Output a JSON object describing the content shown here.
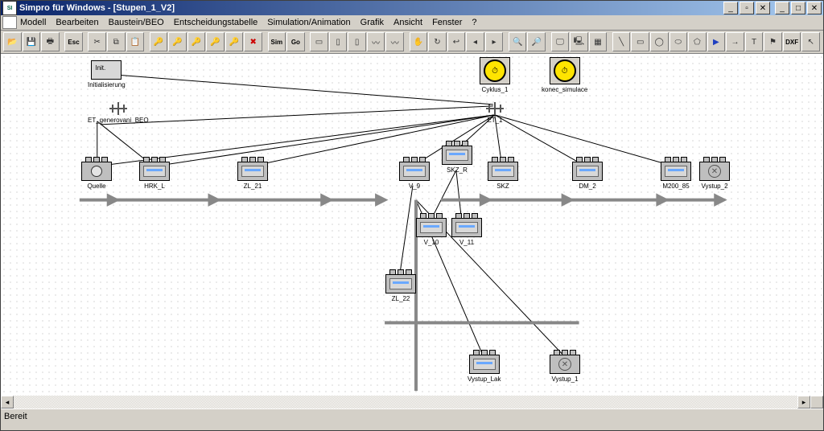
{
  "window_title": "Simpro für Windows - [Stupen_1_V2]",
  "menu": [
    "Modell",
    "Bearbeiten",
    "Baustein/BEO",
    "Entscheidungstabelle",
    "Simulation/Animation",
    "Grafik",
    "Ansicht",
    "Fenster",
    "?"
  ],
  "status": "Bereit",
  "winbtns": {
    "min": "_",
    "doc_min": "_",
    "doc_max": "▫",
    "max": "□",
    "close": "✕"
  },
  "toolbar_icons": [
    "open",
    "save",
    "print",
    "esc",
    "cut",
    "copy",
    "paste",
    "key1",
    "key2",
    "key3",
    "key4",
    "key5",
    "del",
    "sim",
    "go",
    "step1",
    "step2",
    "step3",
    "step4",
    "step5",
    "hand",
    "rot",
    "rev",
    "back",
    "fwd",
    "find",
    "find-next",
    "monitor",
    "pc",
    "chip",
    "line",
    "rect",
    "circ",
    "rrect",
    "poly",
    "tri-fill",
    "arrow",
    "text",
    "flag",
    "dxf",
    "cursor"
  ],
  "icon_glyph": {
    "open": "📂",
    "save": "💾",
    "print": "🖶",
    "esc": "Esc",
    "cut": "✂",
    "copy": "⧉",
    "paste": "📋",
    "key1": "🔑",
    "key2": "🔑",
    "key3": "🔑",
    "key4": "🔑",
    "key5": "🔑",
    "del": "✖",
    "sim": "Sim",
    "go": "Go",
    "step1": "▭",
    "step2": "▯",
    "step3": "▯",
    "step4": "〰",
    "step5": "〰",
    "hand": "✋",
    "rot": "↻",
    "rev": "↩",
    "back": "◂",
    "fwd": "▸",
    "find": "🔍",
    "find-next": "🔎",
    "monitor": "🖵",
    "pc": "🖳",
    "chip": "▦",
    "line": "╲",
    "rect": "▭",
    "circ": "◯",
    "rrect": "⬭",
    "poly": "⬠",
    "tri-fill": "▶",
    "arrow": "→",
    "text": "T",
    "flag": "⚑",
    "dxf": "DXF",
    "cursor": "↖"
  },
  "icon_color": {
    "del": "#c00",
    "tri-fill": "#2040c0",
    "sim": "#000",
    "go": "#000",
    "dxf": "#000",
    "esc": "#000"
  },
  "nodes": {
    "init": {
      "label": "Initialisierung"
    },
    "etgen": {
      "label": "ET_generovani_BEO"
    },
    "cyklus": {
      "label": "Cyklus_1"
    },
    "konec": {
      "label": "konec_simulace"
    },
    "et1": {
      "label": "ET_1"
    },
    "quelle": {
      "label": "Quelle"
    },
    "hrk": {
      "label": "HRK_L"
    },
    "zl21": {
      "label": "ZL_21"
    },
    "v9": {
      "label": "V_9"
    },
    "skzr": {
      "label": "SKZ_R"
    },
    "skz": {
      "label": "SKZ"
    },
    "dm2": {
      "label": "DM_2"
    },
    "m200": {
      "label": "M200_85"
    },
    "vystup2": {
      "label": "Vystup_2"
    },
    "v10": {
      "label": "V_10"
    },
    "v11": {
      "label": "V_11"
    },
    "zl22": {
      "label": "ZL_22"
    },
    "vlak": {
      "label": "Vystup_Lak"
    },
    "vystup1": {
      "label": "Vystup_1"
    }
  }
}
